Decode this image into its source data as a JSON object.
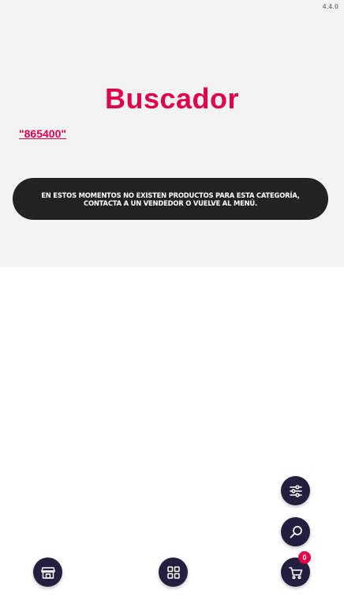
{
  "app": {
    "version": "4.4.0"
  },
  "header": {
    "title": "Buscador"
  },
  "search": {
    "query": "\"865400\""
  },
  "notice": {
    "message": "EN ESTOS MOMENTOS NO EXISTEN PRODUCTOS PARA ESTA CATEGORÍA, CONTACTA A UN VENDEDOR O VUELVE AL MENÚ."
  },
  "cart": {
    "count": "0"
  },
  "icons": {
    "filters": "sliders-icon",
    "search": "search-icon",
    "cart": "cart-icon",
    "store": "store-icon",
    "menu": "grid-icon"
  },
  "colors": {
    "accent": "#e0004d",
    "fab": "#241f3e",
    "notice_bg": "#222222",
    "panel_bg": "#f3f3f3"
  }
}
